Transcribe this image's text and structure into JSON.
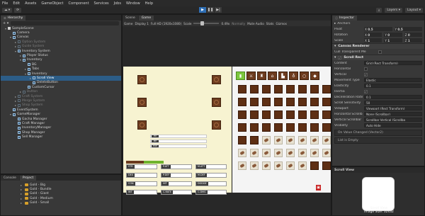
{
  "menubar": [
    "File",
    "Edit",
    "Assets",
    "GameObject",
    "Component",
    "Services",
    "Jobs",
    "Window",
    "Help"
  ],
  "toolbar": {
    "layers": "Layers",
    "layout": "Layout"
  },
  "hierarchy": {
    "tab": "Hierarchy",
    "rows": [
      {
        "label": "SampleScene",
        "depth": 0,
        "arrow": "▾",
        "kind": "scene",
        "dim": false,
        "sel": false
      },
      {
        "label": "Camera",
        "depth": 1,
        "arrow": "",
        "kind": "go",
        "dim": false,
        "sel": false
      },
      {
        "label": "Canvas",
        "depth": 1,
        "arrow": "▾",
        "kind": "go",
        "dim": false,
        "sel": false
      },
      {
        "label": "Option System",
        "depth": 2,
        "arrow": "▸",
        "kind": "go",
        "dim": true,
        "sel": false
      },
      {
        "label": "Guide System",
        "depth": 2,
        "arrow": "▸",
        "kind": "go",
        "dim": true,
        "sel": false
      },
      {
        "label": "Inventory System",
        "depth": 2,
        "arrow": "▾",
        "kind": "go",
        "dim": false,
        "sel": false
      },
      {
        "label": "Player Status",
        "depth": 3,
        "arrow": "▸",
        "kind": "go",
        "dim": false,
        "sel": false
      },
      {
        "label": "Inventory",
        "depth": 3,
        "arrow": "▾",
        "kind": "go",
        "dim": false,
        "sel": false
      },
      {
        "label": "BG",
        "depth": 4,
        "arrow": "",
        "kind": "go",
        "dim": false,
        "sel": false
      },
      {
        "label": "Tabs",
        "depth": 4,
        "arrow": "▸",
        "kind": "go",
        "dim": false,
        "sel": false
      },
      {
        "label": "Inventory",
        "depth": 4,
        "arrow": "▾",
        "kind": "go",
        "dim": false,
        "sel": false
      },
      {
        "label": "Scroll View",
        "depth": 5,
        "arrow": "▸",
        "kind": "go",
        "dim": false,
        "sel": true
      },
      {
        "label": "DeleteButton",
        "depth": 5,
        "arrow": "",
        "kind": "go",
        "dim": false,
        "sel": false
      },
      {
        "label": "CustomCursor",
        "depth": 4,
        "arrow": "",
        "kind": "go",
        "dim": false,
        "sel": false
      },
      {
        "label": "Button",
        "depth": 3,
        "arrow": "▸",
        "kind": "go",
        "dim": true,
        "sel": false
      },
      {
        "label": "Craft System",
        "depth": 2,
        "arrow": "▸",
        "kind": "go",
        "dim": true,
        "sel": false
      },
      {
        "label": "Merge System",
        "depth": 2,
        "arrow": "▸",
        "kind": "go",
        "dim": true,
        "sel": false
      },
      {
        "label": "Shop System",
        "depth": 2,
        "arrow": "▸",
        "kind": "go",
        "dim": true,
        "sel": false
      },
      {
        "label": "EventSystem",
        "depth": 1,
        "arrow": "",
        "kind": "go",
        "dim": false,
        "sel": false
      },
      {
        "label": "GameManager",
        "depth": 1,
        "arrow": "▾",
        "kind": "go",
        "dim": false,
        "sel": false
      },
      {
        "label": "Gacha Manager",
        "depth": 2,
        "arrow": "",
        "kind": "go",
        "dim": false,
        "sel": false
      },
      {
        "label": "Craft Manager",
        "depth": 2,
        "arrow": "",
        "kind": "go",
        "dim": false,
        "sel": false
      },
      {
        "label": "InventoryManager",
        "depth": 2,
        "arrow": "",
        "kind": "go",
        "dim": false,
        "sel": false
      },
      {
        "label": "Shop Manager",
        "depth": 2,
        "arrow": "",
        "kind": "go",
        "dim": false,
        "sel": false
      },
      {
        "label": "Sell Manager",
        "depth": 2,
        "arrow": "",
        "kind": "go",
        "dim": false,
        "sel": false
      }
    ]
  },
  "project": {
    "tabs": [
      "Console",
      "Project"
    ],
    "rows": [
      {
        "label": "Gold - Big",
        "arrow": "▸"
      },
      {
        "label": "Gold - Bundle",
        "arrow": "▸"
      },
      {
        "label": "Gold - Giant",
        "arrow": "▸"
      },
      {
        "label": "Gold - Medium",
        "arrow": "▸"
      },
      {
        "label": "Gold - Small",
        "arrow": "▸"
      }
    ]
  },
  "game": {
    "tabs": [
      "Scene",
      "Game"
    ],
    "toolbar": {
      "mode": "Game",
      "display": "Display 1",
      "resolution": "Full HD (1920x1080)",
      "scale_label": "Scale",
      "scale_value": "0.49x",
      "play_focused": "Normally",
      "mute": "Mute Audio",
      "stats": "Stats",
      "gizmos": "Gizmos"
    },
    "status_bars": [
      {
        "label": "HP"
      },
      {
        "label": "MP"
      },
      {
        "label": "EXP"
      }
    ],
    "stats": [
      "STR",
      "P.ATT",
      "M.ATT",
      "DEX",
      "P.DEF",
      "M.DEF",
      "CON",
      "HIT",
      "DODGE",
      "INT",
      "C.RATE",
      "C.DMG"
    ]
  },
  "inspector": {
    "tab": "Inspector",
    "anchors": "Anchors",
    "pivot": {
      "label": "Pivot",
      "x": "0.5",
      "y": "0.5"
    },
    "rotation": {
      "label": "Rotation",
      "x": "0",
      "y": "0",
      "z": "0"
    },
    "scale": {
      "label": "Scale",
      "x": "1",
      "y": "1",
      "z": "1"
    },
    "canvas_renderer": "Canvas Renderer",
    "cull": "Cull Transparent Me",
    "scroll_rect": "Scroll Rect",
    "fields": [
      {
        "k": "Content",
        "v": "Grid (Rect Transform)"
      },
      {
        "k": "Horizontal",
        "v": ""
      },
      {
        "k": "Vertical",
        "v": "✓"
      },
      {
        "k": "Movement Type",
        "v": "Elastic"
      },
      {
        "k": "Elasticity",
        "v": "0.1"
      },
      {
        "k": "Inertia",
        "v": "✓"
      },
      {
        "k": "Deceleration Rate",
        "v": "0.1"
      },
      {
        "k": "Scroll Sensitivity",
        "v": "50"
      },
      {
        "k": "Viewport",
        "v": "Viewport (Rect Transform)"
      },
      {
        "k": "Horizontal Scrollbar",
        "v": "None (Scrollbar)"
      },
      {
        "k": "Vertical Scrollbar",
        "v": "Scrollbar Vertical (Scrollba"
      },
      {
        "k": "Visibility",
        "v": "Auto Hide"
      }
    ],
    "on_value_changed": "On Value Changed (Vector2)",
    "list_empty": "List is Empty"
  },
  "preview": {
    "title": "Scroll View",
    "caption": "Scroll View\nImage Size: 32x32"
  }
}
